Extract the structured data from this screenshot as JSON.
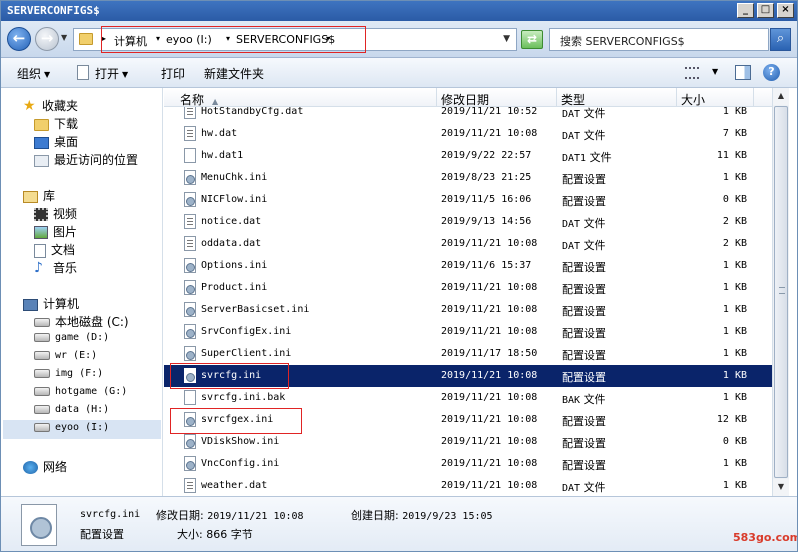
{
  "window": {
    "title": "SERVERCONFIGS$"
  },
  "address": {
    "crumbs": [
      "计算机",
      "eyoo (I:)",
      "SERVERCONFIGS$"
    ],
    "search_placeholder": "搜索 SERVERCONFIGS$"
  },
  "toolbar": {
    "organize": "组织",
    "open": "打开",
    "print": "打印",
    "new_folder": "新建文件夹"
  },
  "nav": {
    "favorites": "收藏夹",
    "download": "下载",
    "desktop": "桌面",
    "recent": "最近访问的位置",
    "libraries": "库",
    "videos": "视频",
    "pictures": "图片",
    "documents": "文档",
    "music": "音乐",
    "computer": "计算机",
    "drives": [
      "本地磁盘 (C:)",
      "game (D:)",
      "wr (E:)",
      "img (F:)",
      "hotgame (G:)",
      "data (H:)",
      "eyoo (I:)"
    ],
    "network": "网络"
  },
  "columns": {
    "name": "名称",
    "date": "修改日期",
    "type": "类型",
    "size": "大小"
  },
  "files": [
    {
      "name": "HotStandbyCfg.dat",
      "date": "2019/11/21 10:52",
      "type_prefix": "DAT",
      "type": "文件",
      "size": "1 KB",
      "icon": "dat"
    },
    {
      "name": "hw.dat",
      "date": "2019/11/21 10:08",
      "type_prefix": "DAT",
      "type": "文件",
      "size": "7 KB",
      "icon": "dat"
    },
    {
      "name": "hw.dat1",
      "date": "2019/9/22 22:57",
      "type_prefix": "DAT1",
      "type": "文件",
      "size": "11 KB",
      "icon": "blank"
    },
    {
      "name": "MenuChk.ini",
      "date": "2019/8/23 21:25",
      "type_prefix": "",
      "type": "配置设置",
      "size": "1 KB",
      "icon": "cfg"
    },
    {
      "name": "NICFlow.ini",
      "date": "2019/11/5 16:06",
      "type_prefix": "",
      "type": "配置设置",
      "size": "0 KB",
      "icon": "cfg"
    },
    {
      "name": "notice.dat",
      "date": "2019/9/13 14:56",
      "type_prefix": "DAT",
      "type": "文件",
      "size": "2 KB",
      "icon": "dat"
    },
    {
      "name": "oddata.dat",
      "date": "2019/11/21 10:08",
      "type_prefix": "DAT",
      "type": "文件",
      "size": "2 KB",
      "icon": "dat"
    },
    {
      "name": "Options.ini",
      "date": "2019/11/6 15:37",
      "type_prefix": "",
      "type": "配置设置",
      "size": "1 KB",
      "icon": "cfg"
    },
    {
      "name": "Product.ini",
      "date": "2019/11/21 10:08",
      "type_prefix": "",
      "type": "配置设置",
      "size": "1 KB",
      "icon": "cfg"
    },
    {
      "name": "ServerBasicset.ini",
      "date": "2019/11/21 10:08",
      "type_prefix": "",
      "type": "配置设置",
      "size": "1 KB",
      "icon": "cfg"
    },
    {
      "name": "SrvConfigEx.ini",
      "date": "2019/11/21 10:08",
      "type_prefix": "",
      "type": "配置设置",
      "size": "1 KB",
      "icon": "cfg"
    },
    {
      "name": "SuperClient.ini",
      "date": "2019/11/17 18:50",
      "type_prefix": "",
      "type": "配置设置",
      "size": "1 KB",
      "icon": "cfg"
    },
    {
      "name": "svrcfg.ini",
      "date": "2019/11/21 10:08",
      "type_prefix": "",
      "type": "配置设置",
      "size": "1 KB",
      "icon": "cfg"
    },
    {
      "name": "svrcfg.ini.bak",
      "date": "2019/11/21 10:08",
      "type_prefix": "BAK",
      "type": "文件",
      "size": "1 KB",
      "icon": "blank"
    },
    {
      "name": "svrcfgex.ini",
      "date": "2019/11/21 10:08",
      "type_prefix": "",
      "type": "配置设置",
      "size": "12 KB",
      "icon": "cfg"
    },
    {
      "name": "VDiskShow.ini",
      "date": "2019/11/21 10:08",
      "type_prefix": "",
      "type": "配置设置",
      "size": "0 KB",
      "icon": "cfg"
    },
    {
      "name": "VncConfig.ini",
      "date": "2019/11/21 10:08",
      "type_prefix": "",
      "type": "配置设置",
      "size": "1 KB",
      "icon": "cfg"
    },
    {
      "name": "weather.dat",
      "date": "2019/11/21 10:08",
      "type_prefix": "DAT",
      "type": "文件",
      "size": "1 KB",
      "icon": "dat"
    }
  ],
  "selected_index": 12,
  "details": {
    "filename": "svrcfg.ini",
    "modified_label": "修改日期:",
    "modified": "2019/11/21 10:08",
    "created_label": "创建日期:",
    "created": "2019/9/23 15:05",
    "type": "配置设置",
    "size_label": "大小:",
    "size": "866 字节"
  },
  "watermark": "583go.com",
  "colors": {
    "selection": "#0a246a",
    "annotation": "#e02424",
    "titlebar": "#2b5ba6"
  }
}
